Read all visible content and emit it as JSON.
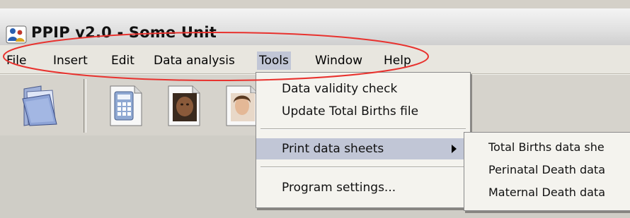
{
  "window": {
    "title": "PPIP v2.0 - Some Unit"
  },
  "menubar": {
    "items": [
      "File",
      "Insert",
      "Edit",
      "Data analysis",
      "Tools",
      "Window",
      "Help"
    ],
    "active": "Tools"
  },
  "toolbar": {
    "icons": [
      "folder-open-icon",
      "calculator-document-icon",
      "baby-document-icon",
      "mother-document-icon"
    ]
  },
  "tools_menu": {
    "items": [
      "Data validity check",
      "Update Total Births file",
      "Print data sheets",
      "Program settings..."
    ],
    "highlighted": "Print data sheets"
  },
  "print_submenu": {
    "items": [
      "Total Births data she",
      "Perinatal Death data",
      "Maternal Death data"
    ]
  },
  "colors": {
    "menu_highlight": "#c1c6d6",
    "annotation": "#e8322e",
    "menu_background": "#f4f3ee"
  }
}
